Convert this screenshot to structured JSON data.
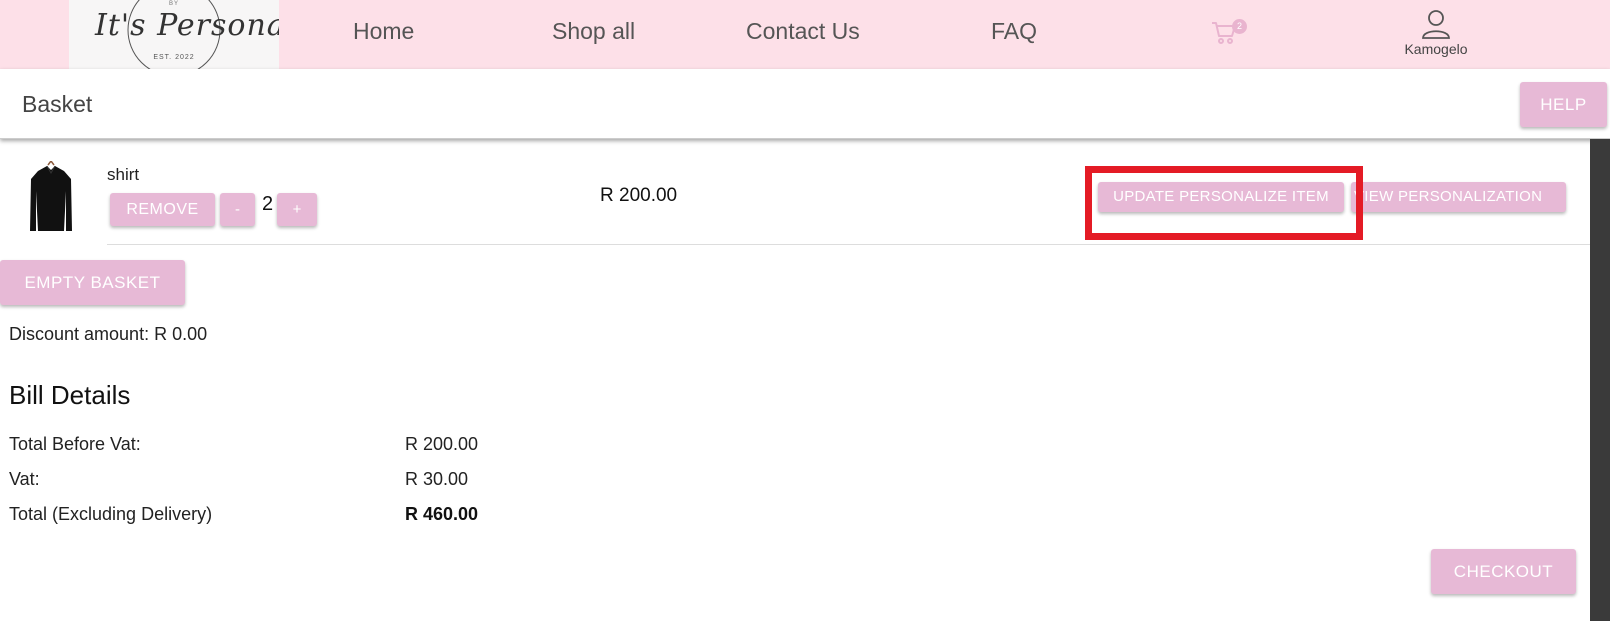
{
  "brand": {
    "logo_text": "It's Personal",
    "logo_tagline": "EST. 2022",
    "logo_top": "BY"
  },
  "nav": {
    "links": [
      "Home",
      "Shop all",
      "Contact Us",
      "FAQ"
    ],
    "cart_count": "2",
    "user_name": "Kamogelo"
  },
  "toolbar": {
    "title": "Basket",
    "help_label": "HELP"
  },
  "basket": {
    "items": [
      {
        "name": "shirt",
        "quantity": "2",
        "price": "R 200.00",
        "remove_label": "REMOVE",
        "minus_label": "-",
        "plus_label": "+",
        "update_label": "UPDATE PERSONALIZE ITEM",
        "view_label": "VIEW PERSONALIZATION"
      }
    ],
    "empty_label": "EMPTY BASKET"
  },
  "summary": {
    "discount": "Discount amount: R 0.00",
    "bill_title": "Bill Details",
    "rows": [
      {
        "label": "Total Before Vat:",
        "value": "R 200.00"
      },
      {
        "label": "Vat:",
        "value": "R 30.00"
      },
      {
        "label": "Total (Excluding Delivery)",
        "value": "R 460.00"
      }
    ],
    "checkout_label": "CHECKOUT"
  },
  "colors": {
    "nav_bg": "#fde0e8",
    "button_bg": "#e7b9d6",
    "highlight": "#e41b25"
  }
}
